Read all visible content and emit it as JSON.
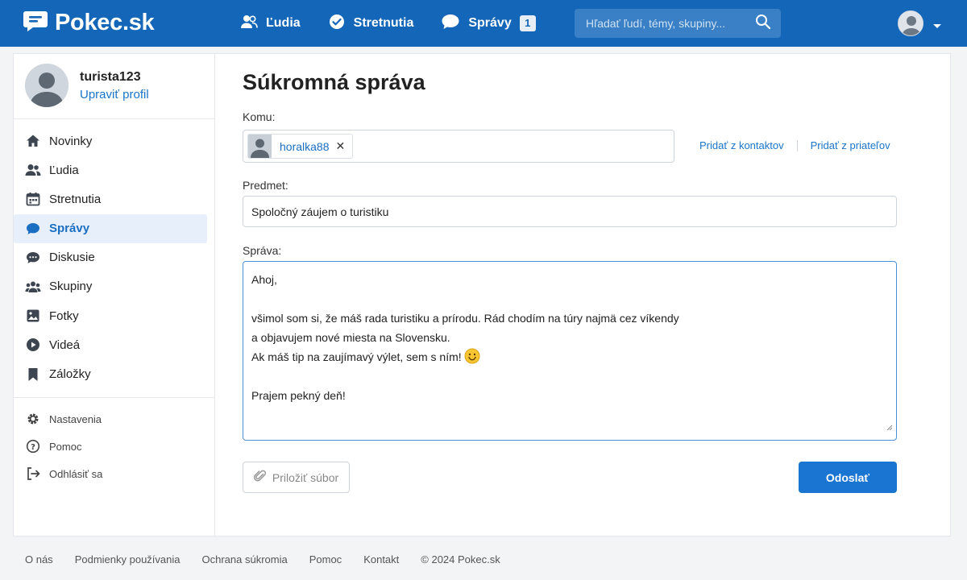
{
  "brand": {
    "name": "Pokec.sk"
  },
  "nav": {
    "people": "Ľudia",
    "meetings": "Stretnutia",
    "messages": "Správy",
    "messages_badge": "1"
  },
  "search": {
    "placeholder": "Hľadať ľudí, témy, skupiny..."
  },
  "profile": {
    "username": "turista123",
    "edit_label": "Upraviť profil"
  },
  "sidebar": {
    "items": [
      {
        "label": "Novinky",
        "icon": "home-icon"
      },
      {
        "label": "Ľudia",
        "icon": "people-icon"
      },
      {
        "label": "Stretnutia",
        "icon": "calendar-icon"
      },
      {
        "label": "Správy",
        "icon": "chat-icon",
        "active": true
      },
      {
        "label": "Diskusie",
        "icon": "discussion-icon"
      },
      {
        "label": "Skupiny",
        "icon": "group-icon"
      },
      {
        "label": "Fotky",
        "icon": "photo-icon"
      },
      {
        "label": "Videá",
        "icon": "video-icon"
      },
      {
        "label": "Záložky",
        "icon": "bookmark-icon"
      }
    ],
    "secondary": [
      {
        "label": "Nastavenia",
        "icon": "gear-icon"
      },
      {
        "label": "Pomoc",
        "icon": "help-icon"
      },
      {
        "label": "Odhlásiť sa",
        "icon": "logout-icon"
      }
    ]
  },
  "compose": {
    "title": "Súkromná správa",
    "to_label": "Komu:",
    "recipient": "horalka88",
    "add_from_contacts": "Pridať z kontaktov",
    "add_from_friends": "Pridať z priateľov",
    "subject_label": "Predmet:",
    "subject_value": "Spoločný záujem o turistiku",
    "message_label": "Správa:",
    "message_lines": [
      "Ahoj,",
      "",
      "všimol som si, že máš rada turistiku a prírodu. Rád chodím na túry najmä cez víkendy",
      "a objavujem nové miesta na Slovensku.",
      "Ak máš tip na zaujímavý výlet, sem s ním!",
      "",
      "Prajem pekný deň!"
    ],
    "attach_label": "Priložiť súbor",
    "send_label": "Odoslať"
  },
  "footer": {
    "links": [
      "O nás",
      "Podmienky používania",
      "Ochrana súkromia",
      "Pomoc",
      "Kontakt"
    ],
    "copyright": "© 2024 Pokec.sk"
  },
  "colors": {
    "brand_blue": "#1466b8",
    "accent_blue": "#1a74d2",
    "active_bg": "#e7f0fa"
  }
}
